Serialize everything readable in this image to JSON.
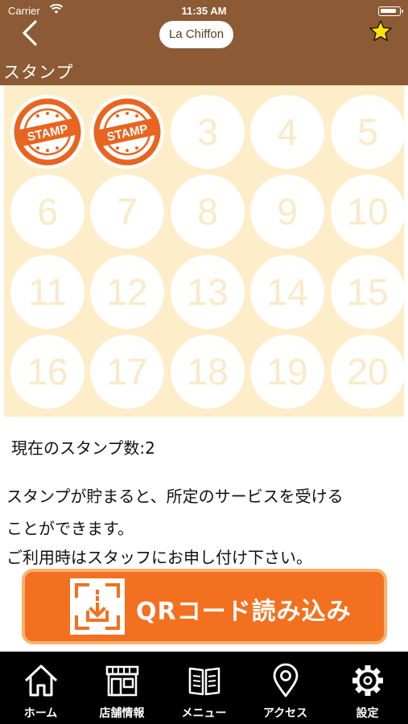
{
  "status_bar": {
    "carrier": "Carrier",
    "time": "11:35 AM",
    "battery_level": 0.9
  },
  "header": {
    "shop_name": "La Chiffon",
    "page_title": "スタンプ"
  },
  "stamp_card": {
    "stamp_mark_text": "STAMP",
    "stamps": [
      {
        "number": "1",
        "stamped": true
      },
      {
        "number": "2",
        "stamped": true
      },
      {
        "number": "3",
        "stamped": false
      },
      {
        "number": "4",
        "stamped": false
      },
      {
        "number": "5",
        "stamped": false
      },
      {
        "number": "6",
        "stamped": false
      },
      {
        "number": "7",
        "stamped": false
      },
      {
        "number": "8",
        "stamped": false
      },
      {
        "number": "9",
        "stamped": false
      },
      {
        "number": "10",
        "stamped": false
      },
      {
        "number": "11",
        "stamped": false
      },
      {
        "number": "12",
        "stamped": false
      },
      {
        "number": "13",
        "stamped": false
      },
      {
        "number": "14",
        "stamped": false
      },
      {
        "number": "15",
        "stamped": false
      },
      {
        "number": "16",
        "stamped": false
      },
      {
        "number": "17",
        "stamped": false
      },
      {
        "number": "18",
        "stamped": false
      },
      {
        "number": "19",
        "stamped": false
      },
      {
        "number": "20",
        "stamped": false
      }
    ]
  },
  "stamp_count_text": "現在のスタンプ数:2",
  "message_lines": [
    "スタンプが貯まると、所定のサービスを受ける",
    "ことができます。",
    "ご利用時はスタッフにお申し付け下さい。"
  ],
  "qr_button": {
    "label": "QRコード読み込み"
  },
  "tabs": [
    {
      "id": "home",
      "label": "ホーム",
      "icon": "home-icon"
    },
    {
      "id": "shop-info",
      "label": "店舗情報",
      "icon": "storefront-icon"
    },
    {
      "id": "menu",
      "label": "メニュー",
      "icon": "book-icon"
    },
    {
      "id": "access",
      "label": "アクセス",
      "icon": "map-pin-icon"
    },
    {
      "id": "settings",
      "label": "設定",
      "icon": "gear-icon"
    }
  ],
  "colors": {
    "header_bg": "#8c5a34",
    "card_bg": "#fdedc9",
    "stamp_orange": "#e8651f",
    "qr_button_bg": "#f2701f",
    "qr_button_border": "#f7b26c",
    "tabbar_bg": "#000000"
  }
}
